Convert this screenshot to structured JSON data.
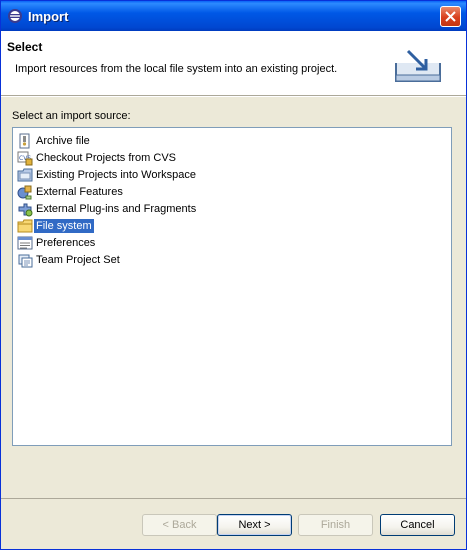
{
  "window": {
    "title": "Import"
  },
  "header": {
    "title": "Select",
    "description": "Import resources from the local file system into an existing project."
  },
  "source_label": "Select an import source:",
  "items": [
    {
      "label": "Archive file",
      "icon": "archive-file-icon"
    },
    {
      "label": "Checkout Projects from CVS",
      "icon": "cvs-icon"
    },
    {
      "label": "Existing Projects into Workspace",
      "icon": "projects-folder-icon"
    },
    {
      "label": "External Features",
      "icon": "features-icon"
    },
    {
      "label": "External Plug-ins and Fragments",
      "icon": "plugin-icon"
    },
    {
      "label": "File system",
      "icon": "folder-icon",
      "selected": true
    },
    {
      "label": "Preferences",
      "icon": "preferences-icon"
    },
    {
      "label": "Team Project Set",
      "icon": "team-project-icon"
    }
  ],
  "buttons": {
    "back": "< Back",
    "next": "Next >",
    "finish": "Finish",
    "cancel": "Cancel"
  },
  "colors": {
    "titlebar": "#0058e6",
    "selection": "#316ac5",
    "dialog_bg": "#ece9d8"
  }
}
